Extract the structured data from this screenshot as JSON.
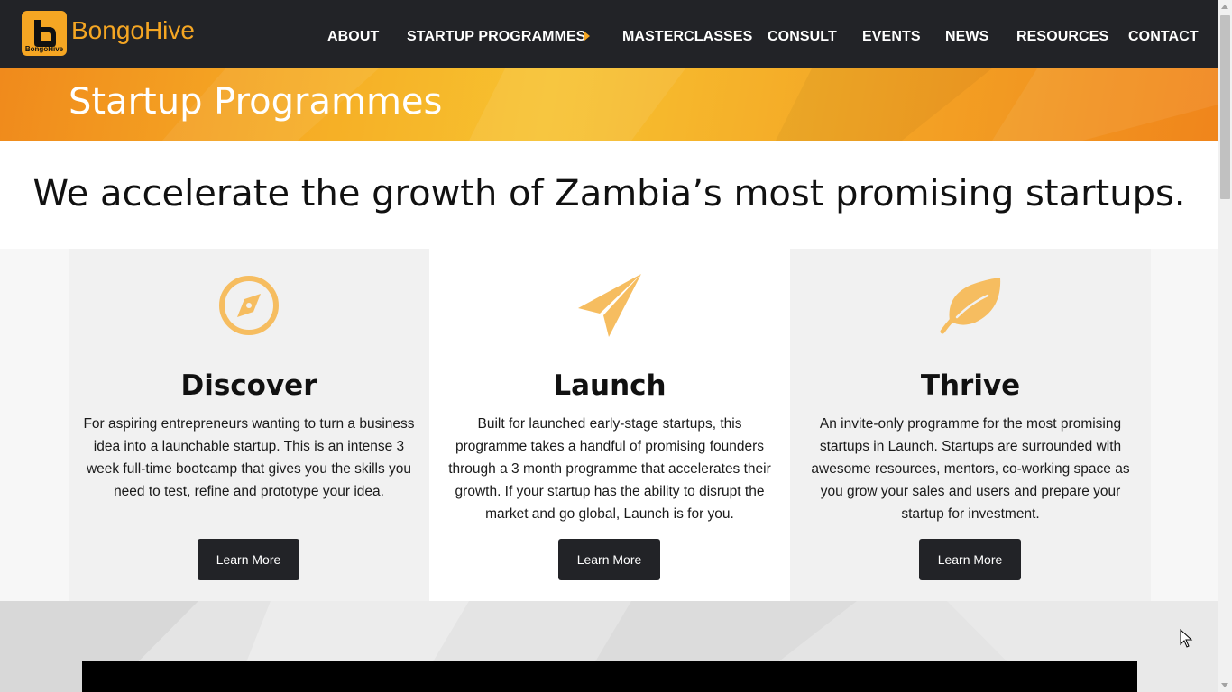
{
  "header": {
    "logo_small_text": "BongoHive",
    "brand_name": "BongoHive",
    "brand_color": "#f5a623",
    "nav": [
      {
        "label": "ABOUT"
      },
      {
        "label": "STARTUP PROGRAMMES",
        "has_submenu": true
      },
      {
        "label": "MASTERCLASSES"
      },
      {
        "label": "CONSULT"
      },
      {
        "label": "EVENTS"
      },
      {
        "label": "NEWS"
      },
      {
        "label": "RESOURCES"
      },
      {
        "label": "CONTACT"
      }
    ]
  },
  "banner": {
    "title": "Startup Programmes"
  },
  "headline": "We accelerate the growth of Zambia’s most promising startups.",
  "programmes": [
    {
      "icon": "compass-icon",
      "title": "Discover",
      "description": "For aspiring entrepreneurs wanting to turn a business idea into a launchable startup.  This is an intense 3 week full-time bootcamp that gives you the skills you need to test, refine and prototype your idea.",
      "button": "Learn More"
    },
    {
      "icon": "paper-plane-icon",
      "title": "Launch",
      "description": "Built for launched early-stage startups, this programme takes a handful of promising founders through a 3 month programme that accelerates their growth.  If your startup has the ability to disrupt the market and go global, Launch is for you.",
      "button": "Learn More"
    },
    {
      "icon": "leaf-icon",
      "title": "Thrive",
      "description": "An invite-only programme for the most promising startups in Launch.  Startups are surrounded with awesome resources, mentors, co-working space as you grow your sales and users and prepare your startup for investment.",
      "button": "Learn More"
    }
  ],
  "colors": {
    "header_bg": "#222327",
    "accent_orange": "#f5a623",
    "icon_color": "#f6bd60",
    "button_bg": "#222327"
  }
}
